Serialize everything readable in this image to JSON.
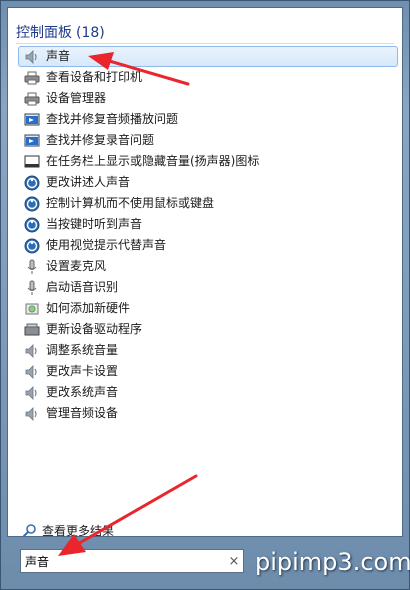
{
  "group": {
    "title": "控制面板",
    "count": "(18)"
  },
  "items": [
    {
      "label": "声音",
      "icon": "speaker-icon",
      "selected": true
    },
    {
      "label": "查看设备和打印机",
      "icon": "printer-icon"
    },
    {
      "label": "设备管理器",
      "icon": "printer-icon"
    },
    {
      "label": "查找并修复音频播放问题",
      "icon": "troubleshoot-icon"
    },
    {
      "label": "查找并修复录音问题",
      "icon": "troubleshoot-icon"
    },
    {
      "label": "在任务栏上显示或隐藏音量(扬声器)图标",
      "icon": "taskbar-icon"
    },
    {
      "label": "更改讲述人声音",
      "icon": "ease-of-access-icon"
    },
    {
      "label": "控制计算机而不使用鼠标或键盘",
      "icon": "ease-of-access-icon"
    },
    {
      "label": "当按键时听到声音",
      "icon": "ease-of-access-icon"
    },
    {
      "label": "使用视觉提示代替声音",
      "icon": "ease-of-access-icon"
    },
    {
      "label": "设置麦克风",
      "icon": "microphone-icon"
    },
    {
      "label": "启动语音识别",
      "icon": "microphone-icon"
    },
    {
      "label": "如何添加新硬件",
      "icon": "hardware-icon"
    },
    {
      "label": "更新设备驱动程序",
      "icon": "driver-icon"
    },
    {
      "label": "调整系统音量",
      "icon": "speaker-icon"
    },
    {
      "label": "更改声卡设置",
      "icon": "speaker-icon"
    },
    {
      "label": "更改系统声音",
      "icon": "speaker-icon"
    },
    {
      "label": "管理音频设备",
      "icon": "speaker-icon"
    }
  ],
  "see_more": {
    "label": "查看更多结果",
    "icon": "search-icon"
  },
  "search": {
    "value": "声音",
    "clear_glyph": "×"
  },
  "watermark": "pipimp3.com",
  "colors": {
    "header": "#1e3b8a",
    "selected_bg": "#d6e8fb",
    "selected_border": "#8fb9e8",
    "annotation_arrow": "#e8262c"
  }
}
